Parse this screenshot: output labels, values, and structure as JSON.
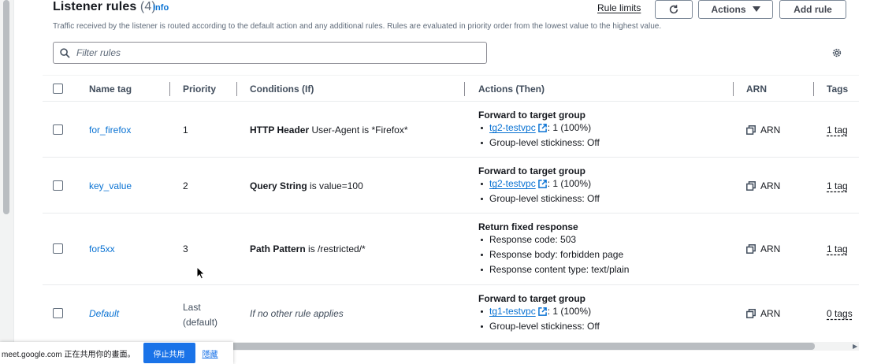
{
  "header": {
    "title": "Listener rules",
    "count": "(4)",
    "info": "Info",
    "description": "Traffic received by the listener is routed according to the default action and any additional rules. Rules are evaluated in priority order from the lowest value to the highest value.",
    "rule_limits": "Rule limits",
    "actions_label": "Actions",
    "add_rule_label": "Add rule"
  },
  "filter": {
    "placeholder": "Filter rules"
  },
  "columns": [
    "Name tag",
    "Priority",
    "Conditions (If)",
    "Actions (Then)",
    "ARN",
    "Tags"
  ],
  "rows": [
    {
      "name": "for_firefox",
      "priority": "1",
      "cond_key": "HTTP Header",
      "cond_val": "User-Agent is *Firefox*",
      "action_title": "Forward to target group",
      "tg": "tg2-testvpc",
      "tg_weight": ": 1 (100%)",
      "stickiness": "Group-level stickiness: Off",
      "arn": "ARN",
      "tags": "1 tag"
    },
    {
      "name": "key_value",
      "priority": "2",
      "cond_key": "Query String",
      "cond_val": "is value=100",
      "action_title": "Forward to target group",
      "tg": "tg2-testvpc",
      "tg_weight": ": 1 (100%)",
      "stickiness": "Group-level stickiness: Off",
      "arn": "ARN",
      "tags": "1 tag"
    },
    {
      "name": "for5xx",
      "priority": "3",
      "cond_key": "Path Pattern",
      "cond_val": "is /restricted/*",
      "action_title": "Return fixed response",
      "resp_code": "Response code: 503",
      "resp_body": "Response body: forbidden page",
      "resp_type": "Response content type: text/plain",
      "arn": "ARN",
      "tags": "1 tag"
    },
    {
      "name": "Default",
      "priority_line1": "Last",
      "priority_line2": "(default)",
      "cond_text": "If no other rule applies",
      "action_title": "Forward to target group",
      "tg": "tg1-testvpc",
      "tg_weight": ": 1 (100%)",
      "stickiness": "Group-level stickiness: Off",
      "arn": "ARN",
      "tags": "0 tags"
    }
  ],
  "share_bar": {
    "text": "meet.google.com 正在共用你的畫面。",
    "stop": "停止共用",
    "hide": "隱藏"
  },
  "colors": {
    "link": "#0972d3",
    "text": "#16191f",
    "muted": "#5f6b7a",
    "meet_blue": "#1a73e8"
  }
}
